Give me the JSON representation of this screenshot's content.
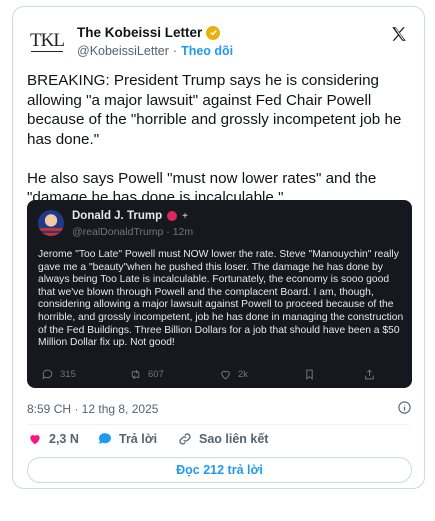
{
  "tweet": {
    "author": {
      "name": "The Kobeissi Letter",
      "handle": "@KobeissiLetter",
      "follow_label": "Theo dõi",
      "avatar_text": "TKL",
      "verified_color": "#e8b10c"
    },
    "text": "BREAKING: President Trump says he is considering allowing \"a major lawsuit\" against Fed Chair Powell because of the \"horrible and grossly incompetent job he has done.\"\n\nHe also says Powell \"must now lower rates\" and the \"damage he has done is incalculable.\"",
    "timestamp": "8:59 CH · 12 thg 8, 2025",
    "actions": {
      "likes": "2,3 N",
      "reply_label": "Trả lời",
      "copy_link_label": "Sao liên kết"
    },
    "read_replies_label": "Đọc 212 trả lời"
  },
  "quoted": {
    "name": "Donald J. Trump",
    "flag": "+",
    "handle": "@realDonaldTrump · 12m",
    "text": "Jerome \"Too Late\" Powell must NOW lower the rate. Steve \"Manouychin\" really gave me a \"beauty\"when he pushed this loser. The damage he has done by always being Too Late is incalculable. Fortunately, the economy is sooo good that we've blown through Powell and the complacent Board. I am, though, considering allowing a major lawsuit against Powell to proceed because of the horrible, and grossly incompetent, job he has done in managing the construction of the Fed Buildings. Three Billion Dollars for a job that should have been a $50 Million Dollar fix up. Not good!",
    "stats": {
      "replies": "315",
      "reposts": "607",
      "likes": "2k"
    }
  },
  "colors": {
    "accent": "#1d9bf0",
    "like": "#f91880",
    "quote_bg": "#15181c"
  }
}
